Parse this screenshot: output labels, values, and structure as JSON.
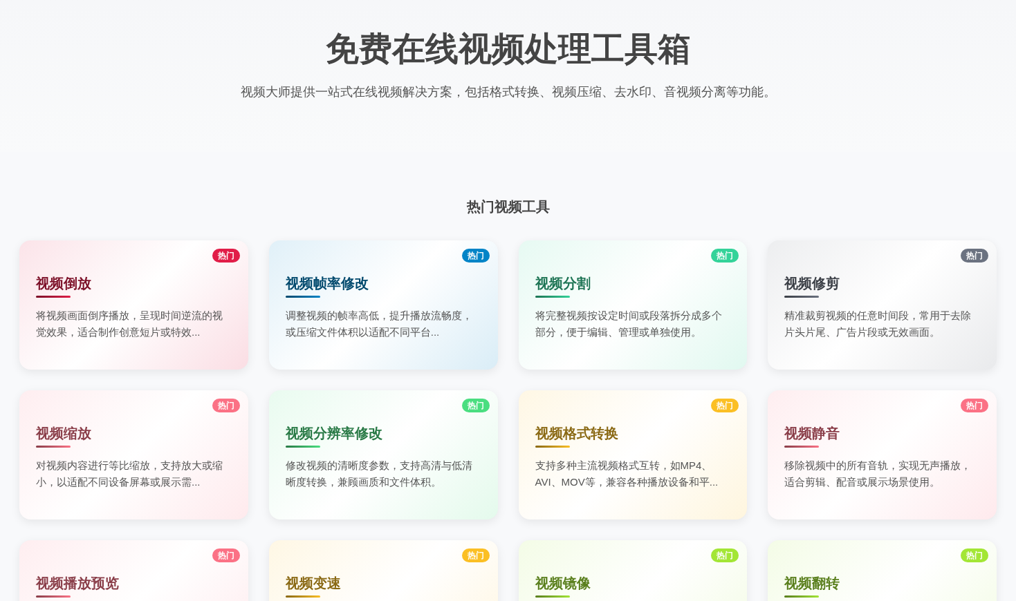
{
  "hero": {
    "title": "免费在线视频处理工具箱",
    "subtitle": "视频大师提供一站式在线视频解决方案，包括格式转换、视频压缩、去水印、音视频分离等功能。"
  },
  "section": {
    "title": "热门视频工具",
    "cards": [
      {
        "title": "视频倒放",
        "badge": "热门",
        "color": "#e11d48",
        "description": "将视频画面倒序播放，呈现时间逆流的视觉效果，适合制作创意短片或特效..."
      },
      {
        "title": "视频帧率修改",
        "badge": "热门",
        "color": "#0284c7",
        "description": "调整视频的帧率高低，提升播放流畅度，或压缩文件体积以适配不同平台..."
      },
      {
        "title": "视频分割",
        "badge": "热门",
        "color": "#34d399",
        "description": "将完整视频按设定时间或段落拆分成多个部分，便于编辑、管理或单独使用。"
      },
      {
        "title": "视频修剪",
        "badge": "热门",
        "color": "#6b7280",
        "description": "精准裁剪视频的任意时间段，常用于去除片头片尾、广告片段或无效画面。"
      },
      {
        "title": "视频缩放",
        "badge": "热门",
        "color": "#fb7185",
        "description": "对视频内容进行等比缩放，支持放大或缩小，以适配不同设备屏幕或展示需..."
      },
      {
        "title": "视频分辨率修改",
        "badge": "热门",
        "color": "#4ade80",
        "description": "修改视频的清晰度参数，支持高清与低清晰度转换，兼顾画质和文件体积。"
      },
      {
        "title": "视频格式转换",
        "badge": "热门",
        "color": "#fbbf24",
        "description": "支持多种主流视频格式互转，如MP4、AVI、MOV等，兼容各种播放设备和平..."
      },
      {
        "title": "视频静音",
        "badge": "热门",
        "color": "#fb7185",
        "description": "移除视频中的所有音轨，实现无声播放，适合剪辑、配音或展示场景使用。"
      },
      {
        "title": "视频播放预览",
        "badge": "热门",
        "color": "#fb7185"
      },
      {
        "title": "视频变速",
        "badge": "热门",
        "color": "#fbbf24"
      },
      {
        "title": "视频镜像",
        "badge": "热门",
        "color": "#a3e635"
      },
      {
        "title": "视频翻转",
        "badge": "热门",
        "color": "#a3e635"
      }
    ]
  }
}
